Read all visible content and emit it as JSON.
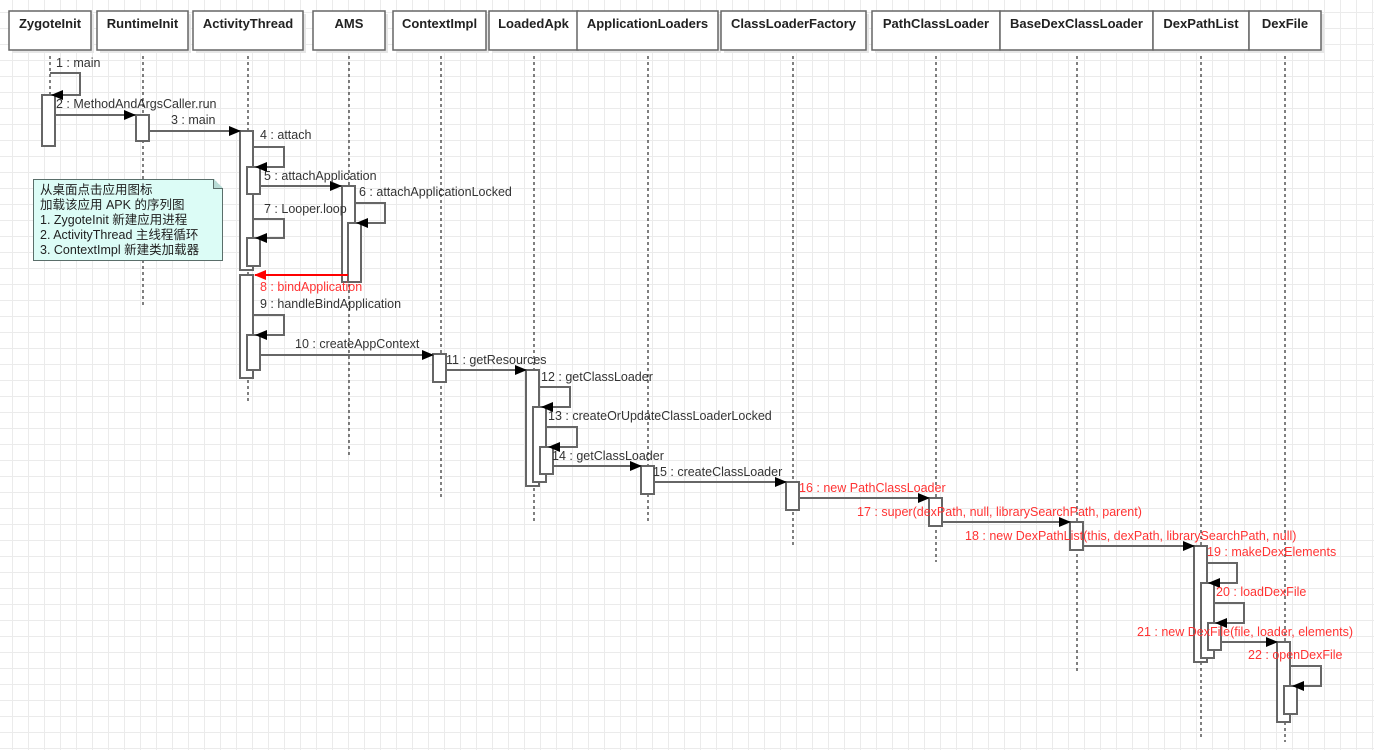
{
  "title": "从桌面点击应用图标加载该应用 APK 的序列图",
  "colors": {
    "line": "#666666",
    "text": "#333333",
    "highlight": "#ff3333",
    "note_bg": "#dcfcf6"
  },
  "participants": [
    {
      "id": "ZygoteInit",
      "label": "ZygoteInit"
    },
    {
      "id": "RuntimeInit",
      "label": "RuntimeInit"
    },
    {
      "id": "ActivityThread",
      "label": "ActivityThread"
    },
    {
      "id": "AMS",
      "label": "AMS"
    },
    {
      "id": "ContextImpl",
      "label": "ContextImpl"
    },
    {
      "id": "LoadedApk",
      "label": "LoadedApk"
    },
    {
      "id": "ApplicationLoaders",
      "label": "ApplicationLoaders"
    },
    {
      "id": "ClassLoaderFactory",
      "label": "ClassLoaderFactory"
    },
    {
      "id": "PathClassLoader",
      "label": "PathClassLoader"
    },
    {
      "id": "BaseDexClassLoader",
      "label": "BaseDexClassLoader"
    },
    {
      "id": "DexPathList",
      "label": "DexPathList"
    },
    {
      "id": "DexFile",
      "label": "DexFile"
    }
  ],
  "messages": [
    {
      "seq": 1,
      "label": "1 : main",
      "from": "ZygoteInit",
      "to": "ZygoteInit",
      "type": "self",
      "highlight": false
    },
    {
      "seq": 2,
      "label": "2 : MethodAndArgsCaller.run",
      "from": "ZygoteInit",
      "to": "RuntimeInit",
      "type": "call",
      "highlight": false
    },
    {
      "seq": 3,
      "label": "3 : main",
      "from": "RuntimeInit",
      "to": "ActivityThread",
      "type": "call",
      "highlight": false
    },
    {
      "seq": 4,
      "label": "4 : attach",
      "from": "ActivityThread",
      "to": "ActivityThread",
      "type": "self",
      "highlight": false
    },
    {
      "seq": 5,
      "label": "5 : attachApplication",
      "from": "ActivityThread",
      "to": "AMS",
      "type": "call",
      "highlight": false
    },
    {
      "seq": 6,
      "label": "6 : attachApplicationLocked",
      "from": "AMS",
      "to": "AMS",
      "type": "self",
      "highlight": false
    },
    {
      "seq": 7,
      "label": "7 : Looper.loop",
      "from": "ActivityThread",
      "to": "ActivityThread",
      "type": "self",
      "highlight": false
    },
    {
      "seq": 8,
      "label": "8 : bindApplication",
      "from": "AMS",
      "to": "ActivityThread",
      "type": "call",
      "highlight": true
    },
    {
      "seq": 9,
      "label": "9 : handleBindApplication",
      "from": "ActivityThread",
      "to": "ActivityThread",
      "type": "self",
      "highlight": false
    },
    {
      "seq": 10,
      "label": "10 : createAppContext",
      "from": "ActivityThread",
      "to": "ContextImpl",
      "type": "call",
      "highlight": false
    },
    {
      "seq": 11,
      "label": "11 : getResources",
      "from": "ContextImpl",
      "to": "LoadedApk",
      "type": "call",
      "highlight": false
    },
    {
      "seq": 12,
      "label": "12 : getClassLoader",
      "from": "LoadedApk",
      "to": "LoadedApk",
      "type": "self",
      "highlight": false
    },
    {
      "seq": 13,
      "label": "13 : createOrUpdateClassLoaderLocked",
      "from": "LoadedApk",
      "to": "LoadedApk",
      "type": "self",
      "highlight": false
    },
    {
      "seq": 14,
      "label": "14 : getClassLoader",
      "from": "LoadedApk",
      "to": "ApplicationLoaders",
      "type": "call",
      "highlight": false
    },
    {
      "seq": 15,
      "label": "15 : createClassLoader",
      "from": "ApplicationLoaders",
      "to": "ClassLoaderFactory",
      "type": "call",
      "highlight": false
    },
    {
      "seq": 16,
      "label": "16 : new PathClassLoader",
      "from": "ClassLoaderFactory",
      "to": "PathClassLoader",
      "type": "call",
      "highlight": true
    },
    {
      "seq": 17,
      "label": "17 : super(dexPath, null, librarySearchPath, parent)",
      "from": "PathClassLoader",
      "to": "BaseDexClassLoader",
      "type": "call",
      "highlight": true
    },
    {
      "seq": 18,
      "label": "18 : new DexPathList(this, dexPath, librarySearchPath, null)",
      "from": "BaseDexClassLoader",
      "to": "DexPathList",
      "type": "call",
      "highlight": true
    },
    {
      "seq": 19,
      "label": "19 : makeDexElements",
      "from": "DexPathList",
      "to": "DexPathList",
      "type": "self",
      "highlight": true
    },
    {
      "seq": 20,
      "label": "20 : loadDexFile",
      "from": "DexPathList",
      "to": "DexPathList",
      "type": "self",
      "highlight": true
    },
    {
      "seq": 21,
      "label": "21 : new DexFile(file, loader, elements)",
      "from": "DexPathList",
      "to": "DexFile",
      "type": "call",
      "highlight": true
    },
    {
      "seq": 22,
      "label": "22 : openDexFile",
      "from": "DexFile",
      "to": "DexFile",
      "type": "self",
      "highlight": true
    }
  ],
  "note": {
    "lines": [
      "从桌面点击应用图标",
      "加载该应用 APK 的序列图",
      "1. ZygoteInit 新建应用进程",
      "2. ActivityThread 主线程循环",
      "3. ContextImpl 新建类加载器"
    ]
  }
}
